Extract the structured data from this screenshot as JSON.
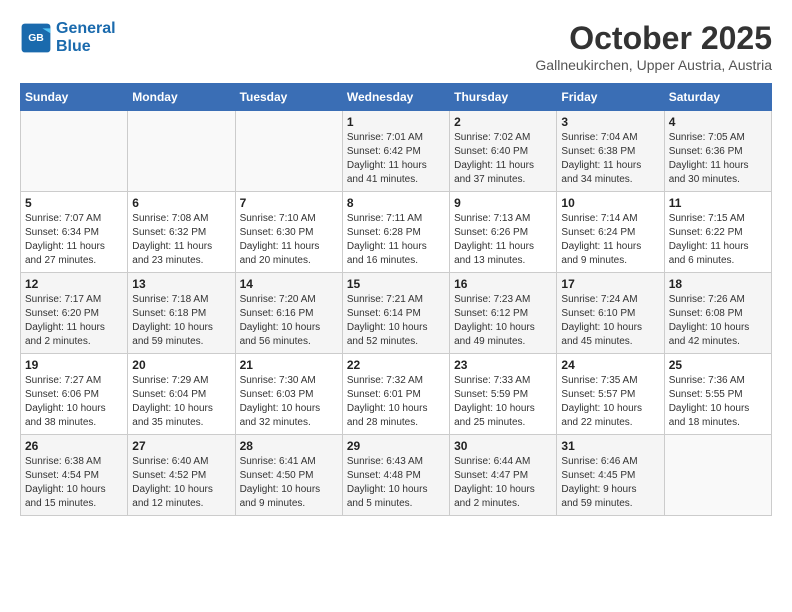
{
  "header": {
    "logo_line1": "General",
    "logo_line2": "Blue",
    "month": "October 2025",
    "location": "Gallneukirchen, Upper Austria, Austria"
  },
  "days_of_week": [
    "Sunday",
    "Monday",
    "Tuesday",
    "Wednesday",
    "Thursday",
    "Friday",
    "Saturday"
  ],
  "weeks": [
    [
      {
        "day": "",
        "info": ""
      },
      {
        "day": "",
        "info": ""
      },
      {
        "day": "",
        "info": ""
      },
      {
        "day": "1",
        "info": "Sunrise: 7:01 AM\nSunset: 6:42 PM\nDaylight: 11 hours\nand 41 minutes."
      },
      {
        "day": "2",
        "info": "Sunrise: 7:02 AM\nSunset: 6:40 PM\nDaylight: 11 hours\nand 37 minutes."
      },
      {
        "day": "3",
        "info": "Sunrise: 7:04 AM\nSunset: 6:38 PM\nDaylight: 11 hours\nand 34 minutes."
      },
      {
        "day": "4",
        "info": "Sunrise: 7:05 AM\nSunset: 6:36 PM\nDaylight: 11 hours\nand 30 minutes."
      }
    ],
    [
      {
        "day": "5",
        "info": "Sunrise: 7:07 AM\nSunset: 6:34 PM\nDaylight: 11 hours\nand 27 minutes."
      },
      {
        "day": "6",
        "info": "Sunrise: 7:08 AM\nSunset: 6:32 PM\nDaylight: 11 hours\nand 23 minutes."
      },
      {
        "day": "7",
        "info": "Sunrise: 7:10 AM\nSunset: 6:30 PM\nDaylight: 11 hours\nand 20 minutes."
      },
      {
        "day": "8",
        "info": "Sunrise: 7:11 AM\nSunset: 6:28 PM\nDaylight: 11 hours\nand 16 minutes."
      },
      {
        "day": "9",
        "info": "Sunrise: 7:13 AM\nSunset: 6:26 PM\nDaylight: 11 hours\nand 13 minutes."
      },
      {
        "day": "10",
        "info": "Sunrise: 7:14 AM\nSunset: 6:24 PM\nDaylight: 11 hours\nand 9 minutes."
      },
      {
        "day": "11",
        "info": "Sunrise: 7:15 AM\nSunset: 6:22 PM\nDaylight: 11 hours\nand 6 minutes."
      }
    ],
    [
      {
        "day": "12",
        "info": "Sunrise: 7:17 AM\nSunset: 6:20 PM\nDaylight: 11 hours\nand 2 minutes."
      },
      {
        "day": "13",
        "info": "Sunrise: 7:18 AM\nSunset: 6:18 PM\nDaylight: 10 hours\nand 59 minutes."
      },
      {
        "day": "14",
        "info": "Sunrise: 7:20 AM\nSunset: 6:16 PM\nDaylight: 10 hours\nand 56 minutes."
      },
      {
        "day": "15",
        "info": "Sunrise: 7:21 AM\nSunset: 6:14 PM\nDaylight: 10 hours\nand 52 minutes."
      },
      {
        "day": "16",
        "info": "Sunrise: 7:23 AM\nSunset: 6:12 PM\nDaylight: 10 hours\nand 49 minutes."
      },
      {
        "day": "17",
        "info": "Sunrise: 7:24 AM\nSunset: 6:10 PM\nDaylight: 10 hours\nand 45 minutes."
      },
      {
        "day": "18",
        "info": "Sunrise: 7:26 AM\nSunset: 6:08 PM\nDaylight: 10 hours\nand 42 minutes."
      }
    ],
    [
      {
        "day": "19",
        "info": "Sunrise: 7:27 AM\nSunset: 6:06 PM\nDaylight: 10 hours\nand 38 minutes."
      },
      {
        "day": "20",
        "info": "Sunrise: 7:29 AM\nSunset: 6:04 PM\nDaylight: 10 hours\nand 35 minutes."
      },
      {
        "day": "21",
        "info": "Sunrise: 7:30 AM\nSunset: 6:03 PM\nDaylight: 10 hours\nand 32 minutes."
      },
      {
        "day": "22",
        "info": "Sunrise: 7:32 AM\nSunset: 6:01 PM\nDaylight: 10 hours\nand 28 minutes."
      },
      {
        "day": "23",
        "info": "Sunrise: 7:33 AM\nSunset: 5:59 PM\nDaylight: 10 hours\nand 25 minutes."
      },
      {
        "day": "24",
        "info": "Sunrise: 7:35 AM\nSunset: 5:57 PM\nDaylight: 10 hours\nand 22 minutes."
      },
      {
        "day": "25",
        "info": "Sunrise: 7:36 AM\nSunset: 5:55 PM\nDaylight: 10 hours\nand 18 minutes."
      }
    ],
    [
      {
        "day": "26",
        "info": "Sunrise: 6:38 AM\nSunset: 4:54 PM\nDaylight: 10 hours\nand 15 minutes."
      },
      {
        "day": "27",
        "info": "Sunrise: 6:40 AM\nSunset: 4:52 PM\nDaylight: 10 hours\nand 12 minutes."
      },
      {
        "day": "28",
        "info": "Sunrise: 6:41 AM\nSunset: 4:50 PM\nDaylight: 10 hours\nand 9 minutes."
      },
      {
        "day": "29",
        "info": "Sunrise: 6:43 AM\nSunset: 4:48 PM\nDaylight: 10 hours\nand 5 minutes."
      },
      {
        "day": "30",
        "info": "Sunrise: 6:44 AM\nSunset: 4:47 PM\nDaylight: 10 hours\nand 2 minutes."
      },
      {
        "day": "31",
        "info": "Sunrise: 6:46 AM\nSunset: 4:45 PM\nDaylight: 9 hours\nand 59 minutes."
      },
      {
        "day": "",
        "info": ""
      }
    ]
  ]
}
